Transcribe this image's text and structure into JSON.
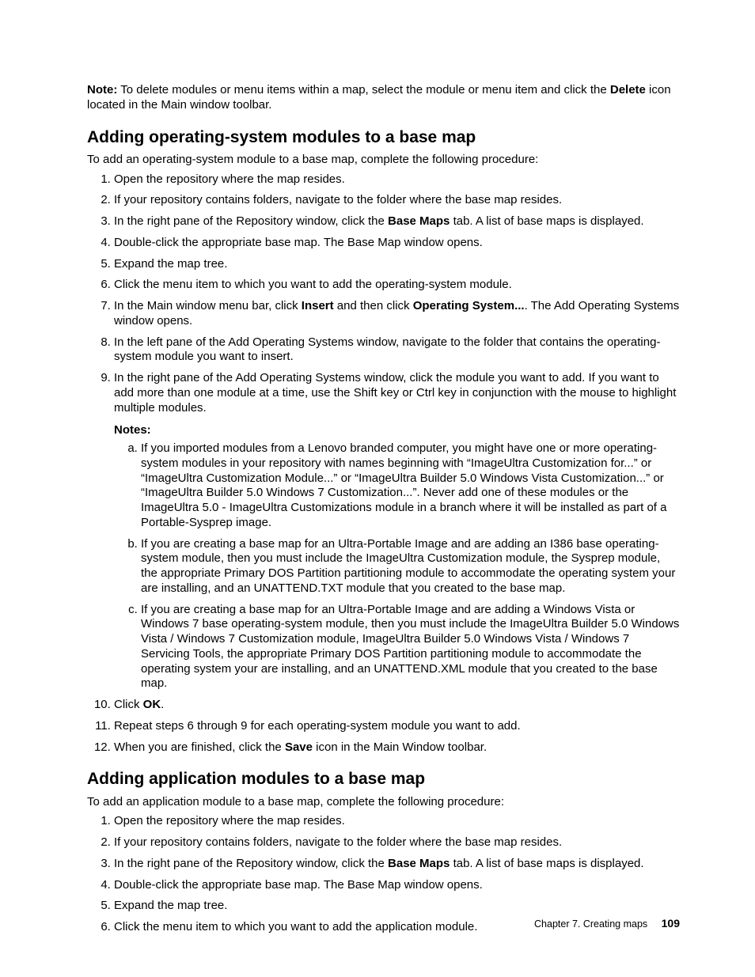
{
  "note1": {
    "prefix": "Note:",
    "body_a": " To delete modules or menu items within a map, select the module or menu item and click the ",
    "bold_a": "Delete",
    "body_b": " icon located in the Main window toolbar."
  },
  "section1": {
    "heading": "Adding operating-system modules to a base map",
    "intro": "To add an operating-system module to a base map, complete the following procedure:",
    "steps": {
      "s1": "Open the repository where the map resides.",
      "s2": "If your repository contains folders, navigate to the folder where the base map resides.",
      "s3_a": "In the right pane of the Repository window, click the ",
      "s3_bold": "Base Maps",
      "s3_b": " tab. A list of base maps is displayed.",
      "s4": "Double-click the appropriate base map. The Base Map window opens.",
      "s5": "Expand the map tree.",
      "s6": "Click the menu item to which you want to add the operating-system module.",
      "s7_a": "In the Main window menu bar, click ",
      "s7_bold1": "Insert",
      "s7_b": " and then click ",
      "s7_bold2": "Operating System...",
      "s7_c": ". The Add Operating Systems window opens.",
      "s8": "In the left pane of the Add Operating Systems window, navigate to the folder that contains the operating-system module you want to insert.",
      "s9": "In the right pane of the Add Operating Systems window, click the module you want to add. If you want to add more than one module at a time, use the Shift key or Ctrl key in conjunction with the mouse to highlight multiple modules.",
      "notes_label": "Notes:",
      "na": "If you imported modules from a Lenovo branded computer, you might have one or more operating-system modules in your repository with names beginning with “ImageUltra Customization for...” or “ImageUltra Customization Module...” or “ImageUltra Builder 5.0 Windows Vista Customization...” or “ImageUltra Builder 5.0 Windows 7 Customization...”. Never add one of these modules or the ImageUltra 5.0 - ImageUltra Customizations module in a branch where it will be installed as part of a Portable-Sysprep image.",
      "nb": "If you are creating a base map for an Ultra-Portable Image and are adding an I386 base operating-system module, then you must include the ImageUltra Customization module, the Sysprep module, the appropriate Primary DOS Partition partitioning module to accommodate the operating system your are installing, and an UNATTEND.TXT module that you created to the base map.",
      "nc": "If you are creating a base map for an Ultra-Portable Image and are adding a Windows Vista or Windows 7 base operating-system module, then you must include the ImageUltra Builder 5.0 Windows Vista / Windows 7 Customization module, ImageUltra Builder 5.0 Windows Vista / Windows 7 Servicing Tools, the appropriate Primary DOS Partition partitioning module to accommodate the operating system your are installing, and an UNATTEND.XML module that you created to the base map.",
      "s10_a": "Click ",
      "s10_bold": "OK",
      "s10_b": ".",
      "s11": "Repeat steps 6 through 9 for each operating-system module you want to add.",
      "s12_a": "When you are finished, click the ",
      "s12_bold": "Save",
      "s12_b": " icon in the Main Window toolbar."
    }
  },
  "section2": {
    "heading": "Adding application modules to a base map",
    "intro": "To add an application module to a base map, complete the following procedure:",
    "steps": {
      "s1": "Open the repository where the map resides.",
      "s2": "If your repository contains folders, navigate to the folder where the base map resides.",
      "s3_a": "In the right pane of the Repository window, click the ",
      "s3_bold": "Base Maps",
      "s3_b": " tab. A list of base maps is displayed.",
      "s4": "Double-click the appropriate base map. The Base Map window opens.",
      "s5": "Expand the map tree.",
      "s6": "Click the menu item to which you want to add the application module."
    }
  },
  "footer": {
    "chapter": "Chapter 7. Creating maps",
    "page": "109"
  }
}
